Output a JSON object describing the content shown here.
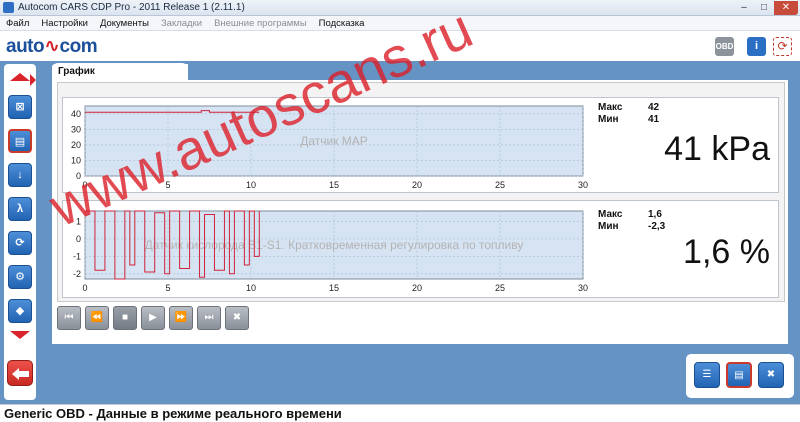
{
  "window": {
    "title": "Autocom CARS CDP Pro - 2011 Release 1 (2.11.1)"
  },
  "menu": {
    "items": [
      {
        "label": "Файл",
        "enabled": true
      },
      {
        "label": "Настройки",
        "enabled": true
      },
      {
        "label": "Документы",
        "enabled": true
      },
      {
        "label": "Закладки",
        "enabled": false
      },
      {
        "label": "Внешние программы",
        "enabled": false
      },
      {
        "label": "Подсказка",
        "enabled": true
      }
    ]
  },
  "toolbar": {
    "logo_left": "auto",
    "logo_right": "com",
    "obd_label": "OBD",
    "info_label": "i"
  },
  "panel": {
    "tab_label": "График"
  },
  "gauges": [
    {
      "label": "Датчик MAP",
      "max_label": "Макс",
      "max_value": "42",
      "min_label": "Мин",
      "min_value": "41",
      "big_value": "41 kPa",
      "chart_data": {
        "type": "line",
        "x": [
          0,
          0.5,
          1,
          1.5,
          2,
          2.5,
          3,
          3.5,
          4,
          4.5,
          5,
          5.5,
          6,
          6.5,
          7,
          7.5,
          8,
          8.5,
          9,
          9.5,
          10,
          10.5
        ],
        "series": [
          {
            "values": [
              41,
              41,
              41,
              41,
              41,
              41,
              41,
              41,
              41,
              41,
              41,
              41,
              41,
              41,
              42,
              41,
              41,
              41,
              41,
              41,
              41,
              41
            ]
          }
        ],
        "xlim": [
          0,
          30
        ],
        "ylim": [
          0,
          45
        ],
        "xticks": [
          0,
          5,
          10,
          15,
          20,
          25,
          30
        ],
        "yticks": [
          0,
          10,
          20,
          30,
          40
        ],
        "grid": true
      }
    },
    {
      "label": "Датчик кислорода B1-S1. Кратковременная регулировка по топливу",
      "max_label": "Макс",
      "max_value": "1,6",
      "min_label": "Мин",
      "min_value": "-2,3",
      "big_value": "1,6 %",
      "chart_data": {
        "type": "line",
        "x": [
          0,
          0.3,
          0.6,
          0.9,
          1.2,
          1.5,
          1.8,
          2.1,
          2.4,
          2.7,
          3.0,
          3.3,
          3.6,
          3.9,
          4.2,
          4.5,
          4.8,
          5.1,
          5.4,
          5.7,
          6.0,
          6.3,
          6.6,
          6.9,
          7.2,
          7.5,
          7.8,
          8.1,
          8.4,
          8.7,
          9.0,
          9.3,
          9.6,
          9.9,
          10.2,
          10.5
        ],
        "series": [
          {
            "values": [
              1.6,
              1.6,
              -1.8,
              -1.8,
              1.6,
              1.6,
              -2.3,
              -2.3,
              1.6,
              -1.5,
              1.6,
              1.6,
              -1.9,
              -1.9,
              1.5,
              1.5,
              -2.0,
              1.6,
              1.6,
              -1.7,
              -1.7,
              1.6,
              1.6,
              -2.2,
              1.4,
              1.4,
              -1.8,
              -1.8,
              1.6,
              -2.0,
              1.6,
              1.6,
              -1.5,
              1.6,
              -1.0,
              1.6
            ]
          }
        ],
        "xlim": [
          0,
          30
        ],
        "ylim": [
          -2.3,
          1.6
        ],
        "xticks": [
          0,
          5,
          10,
          15,
          20,
          25,
          30
        ],
        "yticks": [
          -2,
          -1,
          0,
          1
        ],
        "grid": true
      }
    }
  ],
  "sidebar": {
    "items": [
      {
        "icon": "engine-icon"
      },
      {
        "icon": "document-icon"
      },
      {
        "icon": "glow-plug-icon"
      },
      {
        "icon": "lambda-icon"
      },
      {
        "icon": "refresh-icon"
      },
      {
        "icon": "test-icon"
      },
      {
        "icon": "car-icon"
      }
    ]
  },
  "status": {
    "text": "Generic OBD - Данные в режиме реального времени"
  },
  "watermark": "www.autoscans.ru"
}
